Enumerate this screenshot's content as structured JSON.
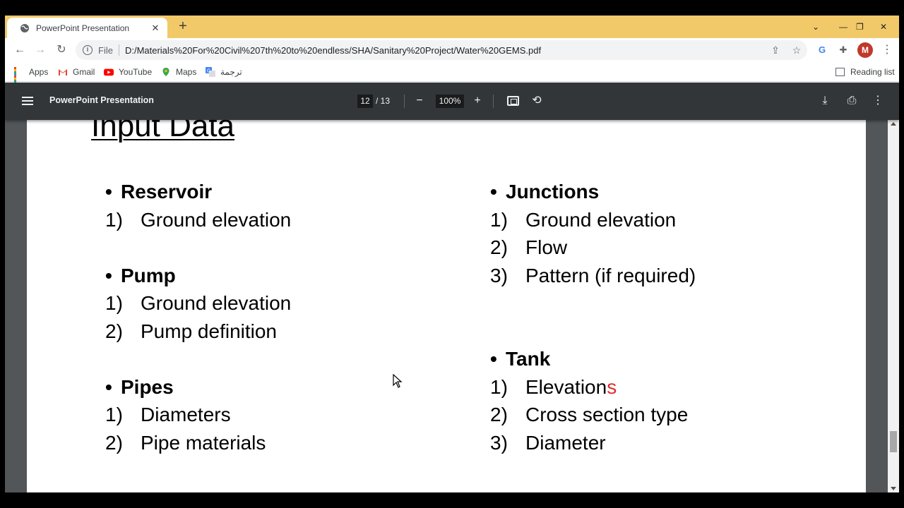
{
  "browser": {
    "tab_title": "PowerPoint Presentation",
    "new_tab": "+",
    "url_scheme_label": "File",
    "url": "D:/Materials%20For%20Civil%207th%20to%20endless/SHA/Sanitary%20Project/Water%20GEMS.pdf",
    "profile_initial": "M",
    "accent_color": "#f2c968"
  },
  "bookmarks": {
    "items": [
      {
        "label": "Apps",
        "icon": "apps-grid-icon"
      },
      {
        "label": "Gmail",
        "icon": "gmail-icon"
      },
      {
        "label": "YouTube",
        "icon": "youtube-icon"
      },
      {
        "label": "Maps",
        "icon": "maps-pin-icon"
      },
      {
        "label": "ترجمة",
        "icon": "translate-icon"
      }
    ],
    "reading_list": "Reading list"
  },
  "pdf_toolbar": {
    "title": "PowerPoint Presentation",
    "current_page": "12",
    "total_pages": "/ 13",
    "zoom": "100%",
    "zoom_out": "−",
    "zoom_in": "+"
  },
  "slide": {
    "title": "Input Data",
    "left": [
      {
        "heading": "Reservoir",
        "items": [
          "Ground elevation"
        ]
      },
      {
        "heading": "Pump",
        "items": [
          "Ground elevation",
          "Pump definition"
        ]
      },
      {
        "heading": "Pipes",
        "items": [
          "Diameters",
          "Pipe materials"
        ]
      }
    ],
    "right": [
      {
        "heading": "Junctions",
        "items": [
          "Ground elevation",
          "Flow",
          "Pattern (if required)"
        ]
      },
      {
        "heading": "Tank",
        "items": [
          "Elevation",
          "Cross section type",
          "Diameter"
        ],
        "first_item_red_suffix": "s"
      }
    ],
    "bullet": "•",
    "numbers": [
      "1)",
      "2)",
      "3)"
    ]
  }
}
